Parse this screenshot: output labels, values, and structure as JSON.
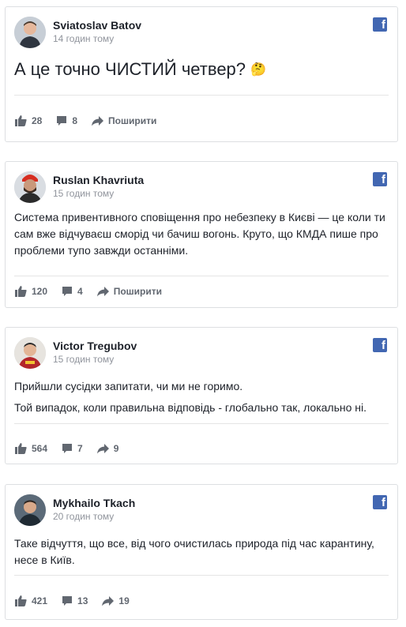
{
  "posts": [
    {
      "author": "Sviatoslav Batov",
      "time": "14 годин тому",
      "text": "А це точно ЧИСТИЙ четвер?",
      "emoji": "🤔",
      "likes": "28",
      "comments": "8",
      "share": "Поширити"
    },
    {
      "author": "Ruslan Khavriuta",
      "time": "15 годин тому",
      "text": "Система привентивного сповіщення про небезпеку в Києві — це коли ти сам вже відчуваєш сморід чи бачиш вогонь. Круто, що КМДА пише про проблеми тупо завжди останніми.",
      "likes": "120",
      "comments": "4",
      "share": "Поширити"
    },
    {
      "author": "Victor Tregubov",
      "time": "15 годин тому",
      "paragraphs": [
        "Прийшли сусідки запитати, чи ми не горимо.",
        "Той випадок, коли правильна відповідь - глобально так, локально ні."
      ],
      "likes": "564",
      "comments": "7",
      "shares": "9"
    },
    {
      "author": "Mykhailo Tkach",
      "time": "20 годин тому",
      "text": "Таке відчуття, що все, від чого очистилась природа під час карантину, несе в Київ.",
      "likes": "421",
      "comments": "13",
      "shares": "19"
    }
  ],
  "colors": {
    "facebook": "#4267b2",
    "meta_text": "#90949c",
    "action_text": "#616770"
  },
  "icons": {
    "facebook": "facebook-icon",
    "like": "thumbs-up-icon",
    "comment": "comment-icon",
    "share": "share-arrow-icon"
  }
}
